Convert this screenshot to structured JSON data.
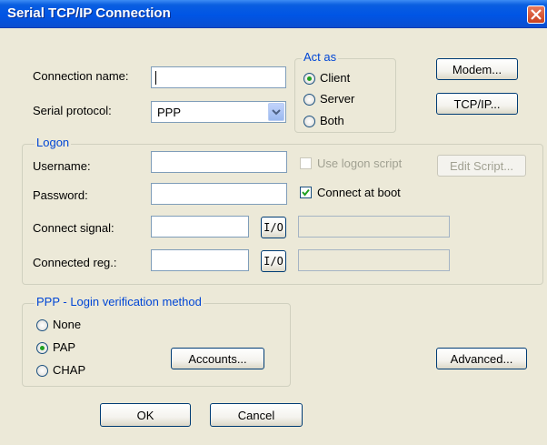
{
  "window": {
    "title": "Serial TCP/IP Connection",
    "close_icon": "close-icon"
  },
  "connection": {
    "name_label": "Connection name:",
    "name_value": "",
    "protocol_label": "Serial protocol:",
    "protocol_value": "PPP"
  },
  "act_as": {
    "title": "Act as",
    "options": [
      "Client",
      "Server",
      "Both"
    ],
    "selected": "Client"
  },
  "side_buttons": {
    "modem": "Modem...",
    "tcpip": "TCP/IP...",
    "advanced": "Advanced..."
  },
  "logon": {
    "title": "Logon",
    "username_label": "Username:",
    "username_value": "",
    "password_label": "Password:",
    "password_value": "",
    "use_logon_script": {
      "label": "Use logon script",
      "checked": false,
      "enabled": false
    },
    "connect_at_boot": {
      "label": "Connect at boot",
      "checked": true
    },
    "edit_script": "Edit Script...",
    "connect_signal_label": "Connect signal:",
    "connected_reg_label": "Connected reg.:",
    "io_label": "I/O"
  },
  "ppp": {
    "title": "PPP - Login verification method",
    "options": [
      "None",
      "PAP",
      "CHAP"
    ],
    "selected": "PAP",
    "accounts": "Accounts..."
  },
  "footer": {
    "ok": "OK",
    "cancel": "Cancel"
  }
}
